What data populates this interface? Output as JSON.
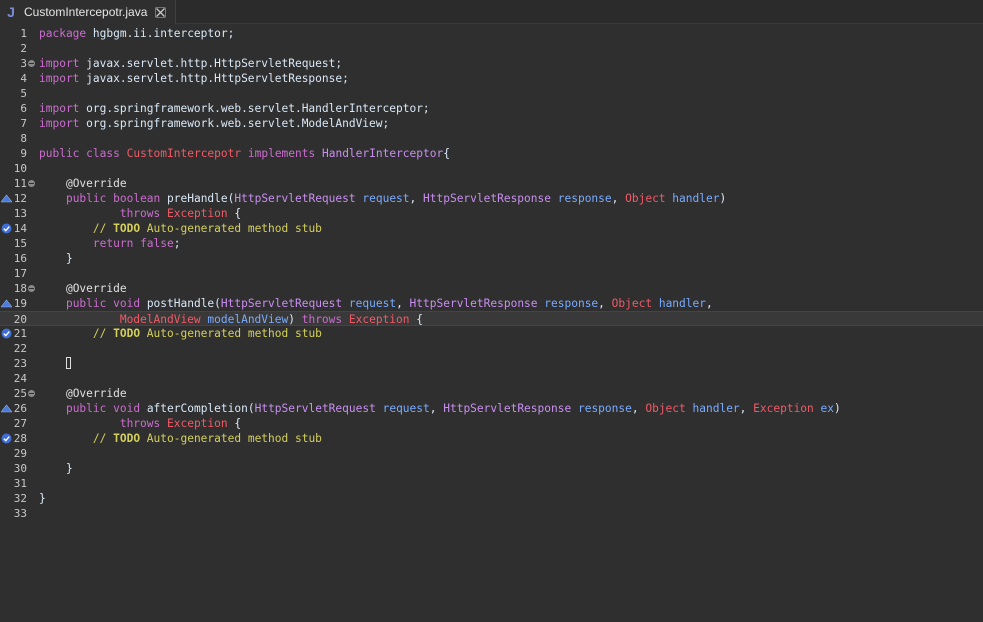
{
  "tab": {
    "icon": "J",
    "title": "CustomIntercepotr.java"
  },
  "editor": {
    "lines": [
      {
        "n": "1",
        "tokens": [
          [
            "kw",
            "package"
          ],
          [
            "plain",
            " hgbgm.ii.interceptor;"
          ]
        ]
      },
      {
        "n": "2",
        "tokens": []
      },
      {
        "n": "3",
        "fold": true,
        "tokens": [
          [
            "kw",
            "import"
          ],
          [
            "plain",
            " javax.servlet.http.HttpServletRequest;"
          ]
        ]
      },
      {
        "n": "4",
        "tokens": [
          [
            "kw",
            "import"
          ],
          [
            "plain",
            " javax.servlet.http.HttpServletResponse;"
          ]
        ]
      },
      {
        "n": "5",
        "tokens": []
      },
      {
        "n": "6",
        "tokens": [
          [
            "kw",
            "import"
          ],
          [
            "plain",
            " org.springframework.web.servlet.HandlerInterceptor;"
          ]
        ]
      },
      {
        "n": "7",
        "tokens": [
          [
            "kw",
            "import"
          ],
          [
            "plain",
            " org.springframework.web.servlet.ModelAndView;"
          ]
        ]
      },
      {
        "n": "8",
        "tokens": []
      },
      {
        "n": "9",
        "tokens": [
          [
            "kw",
            "public"
          ],
          [
            "plain",
            " "
          ],
          [
            "kw",
            "class"
          ],
          [
            "plain",
            " "
          ],
          [
            "cls",
            "CustomIntercepotr"
          ],
          [
            "plain",
            " "
          ],
          [
            "kw",
            "implements"
          ],
          [
            "plain",
            " "
          ],
          [
            "iface",
            "HandlerInterceptor"
          ],
          [
            "plain",
            "{"
          ]
        ]
      },
      {
        "n": "10",
        "tokens": []
      },
      {
        "n": "11",
        "fold": true,
        "tokens": [
          [
            "plain",
            "    "
          ],
          [
            "ann",
            "@Override"
          ]
        ]
      },
      {
        "n": "12",
        "marker": "override",
        "tokens": [
          [
            "plain",
            "    "
          ],
          [
            "kw",
            "public"
          ],
          [
            "plain",
            " "
          ],
          [
            "kw",
            "boolean"
          ],
          [
            "plain",
            " preHandle("
          ],
          [
            "type",
            "HttpServletRequest"
          ],
          [
            "plain",
            " "
          ],
          [
            "param",
            "request"
          ],
          [
            "plain",
            ", "
          ],
          [
            "type",
            "HttpServletResponse"
          ],
          [
            "plain",
            " "
          ],
          [
            "param",
            "response"
          ],
          [
            "plain",
            ", "
          ],
          [
            "cls",
            "Object"
          ],
          [
            "plain",
            " "
          ],
          [
            "param",
            "handler"
          ],
          [
            "plain",
            ")"
          ]
        ]
      },
      {
        "n": "13",
        "tokens": [
          [
            "plain",
            "            "
          ],
          [
            "kw",
            "throws"
          ],
          [
            "plain",
            " "
          ],
          [
            "cls",
            "Exception"
          ],
          [
            "plain",
            " {"
          ]
        ]
      },
      {
        "n": "14",
        "marker": "task",
        "tokens": [
          [
            "plain",
            "        "
          ],
          [
            "cmt",
            "// "
          ],
          [
            "todo",
            "TODO"
          ],
          [
            "cmt",
            " Auto-generated method stub"
          ]
        ]
      },
      {
        "n": "15",
        "tokens": [
          [
            "plain",
            "        "
          ],
          [
            "kw",
            "return"
          ],
          [
            "plain",
            " "
          ],
          [
            "kw",
            "false"
          ],
          [
            "plain",
            ";"
          ]
        ]
      },
      {
        "n": "16",
        "tokens": [
          [
            "plain",
            "    }"
          ]
        ]
      },
      {
        "n": "17",
        "tokens": []
      },
      {
        "n": "18",
        "fold": true,
        "tokens": [
          [
            "plain",
            "    "
          ],
          [
            "ann",
            "@Override"
          ]
        ]
      },
      {
        "n": "19",
        "marker": "override",
        "tokens": [
          [
            "plain",
            "    "
          ],
          [
            "kw",
            "public"
          ],
          [
            "plain",
            " "
          ],
          [
            "kw",
            "void"
          ],
          [
            "plain",
            " postHandle("
          ],
          [
            "type",
            "HttpServletRequest"
          ],
          [
            "plain",
            " "
          ],
          [
            "param",
            "request"
          ],
          [
            "plain",
            ", "
          ],
          [
            "type",
            "HttpServletResponse"
          ],
          [
            "plain",
            " "
          ],
          [
            "param",
            "response"
          ],
          [
            "plain",
            ", "
          ],
          [
            "cls",
            "Object"
          ],
          [
            "plain",
            " "
          ],
          [
            "param",
            "handler"
          ],
          [
            "plain",
            ","
          ]
        ]
      },
      {
        "n": "20",
        "current": true,
        "tokens": [
          [
            "plain",
            "            "
          ],
          [
            "cls",
            "ModelAndView"
          ],
          [
            "plain",
            " "
          ],
          [
            "param",
            "modelAndView"
          ],
          [
            "plain",
            ") "
          ],
          [
            "kw",
            "throws"
          ],
          [
            "plain",
            " "
          ],
          [
            "cls",
            "Exception"
          ],
          [
            "plain",
            " {"
          ]
        ]
      },
      {
        "n": "21",
        "marker": "task",
        "tokens": [
          [
            "plain",
            "        "
          ],
          [
            "cmt",
            "// "
          ],
          [
            "todo",
            "TODO"
          ],
          [
            "cmt",
            " Auto-generated method stub"
          ]
        ]
      },
      {
        "n": "22",
        "tokens": []
      },
      {
        "n": "23",
        "caret": true,
        "tokens": [
          [
            "plain",
            "    "
          ]
        ]
      },
      {
        "n": "24",
        "tokens": []
      },
      {
        "n": "25",
        "fold": true,
        "tokens": [
          [
            "plain",
            "    "
          ],
          [
            "ann",
            "@Override"
          ]
        ]
      },
      {
        "n": "26",
        "marker": "override",
        "tokens": [
          [
            "plain",
            "    "
          ],
          [
            "kw",
            "public"
          ],
          [
            "plain",
            " "
          ],
          [
            "kw",
            "void"
          ],
          [
            "plain",
            " afterCompletion("
          ],
          [
            "type",
            "HttpServletRequest"
          ],
          [
            "plain",
            " "
          ],
          [
            "param",
            "request"
          ],
          [
            "plain",
            ", "
          ],
          [
            "type",
            "HttpServletResponse"
          ],
          [
            "plain",
            " "
          ],
          [
            "param",
            "response"
          ],
          [
            "plain",
            ", "
          ],
          [
            "cls",
            "Object"
          ],
          [
            "plain",
            " "
          ],
          [
            "param",
            "handler"
          ],
          [
            "plain",
            ", "
          ],
          [
            "cls",
            "Exception"
          ],
          [
            "plain",
            " "
          ],
          [
            "param",
            "ex"
          ],
          [
            "plain",
            ")"
          ]
        ]
      },
      {
        "n": "27",
        "tokens": [
          [
            "plain",
            "            "
          ],
          [
            "kw",
            "throws"
          ],
          [
            "plain",
            " "
          ],
          [
            "cls",
            "Exception"
          ],
          [
            "plain",
            " {"
          ]
        ]
      },
      {
        "n": "28",
        "marker": "task",
        "tokens": [
          [
            "plain",
            "        "
          ],
          [
            "cmt",
            "// "
          ],
          [
            "todo",
            "TODO"
          ],
          [
            "cmt",
            " Auto-generated method stub"
          ]
        ]
      },
      {
        "n": "29",
        "tokens": []
      },
      {
        "n": "30",
        "tokens": [
          [
            "plain",
            "    }"
          ]
        ]
      },
      {
        "n": "31",
        "tokens": []
      },
      {
        "n": "32",
        "tokens": [
          [
            "plain",
            "}"
          ]
        ]
      },
      {
        "n": "33",
        "tokens": []
      }
    ]
  },
  "icons": {
    "tab_icon": "java-file-icon",
    "tab_close": "close-icon",
    "override_marker": "override-triangle-icon",
    "task_marker": "task-check-icon",
    "fold_marker": "fold-collapse-icon"
  }
}
